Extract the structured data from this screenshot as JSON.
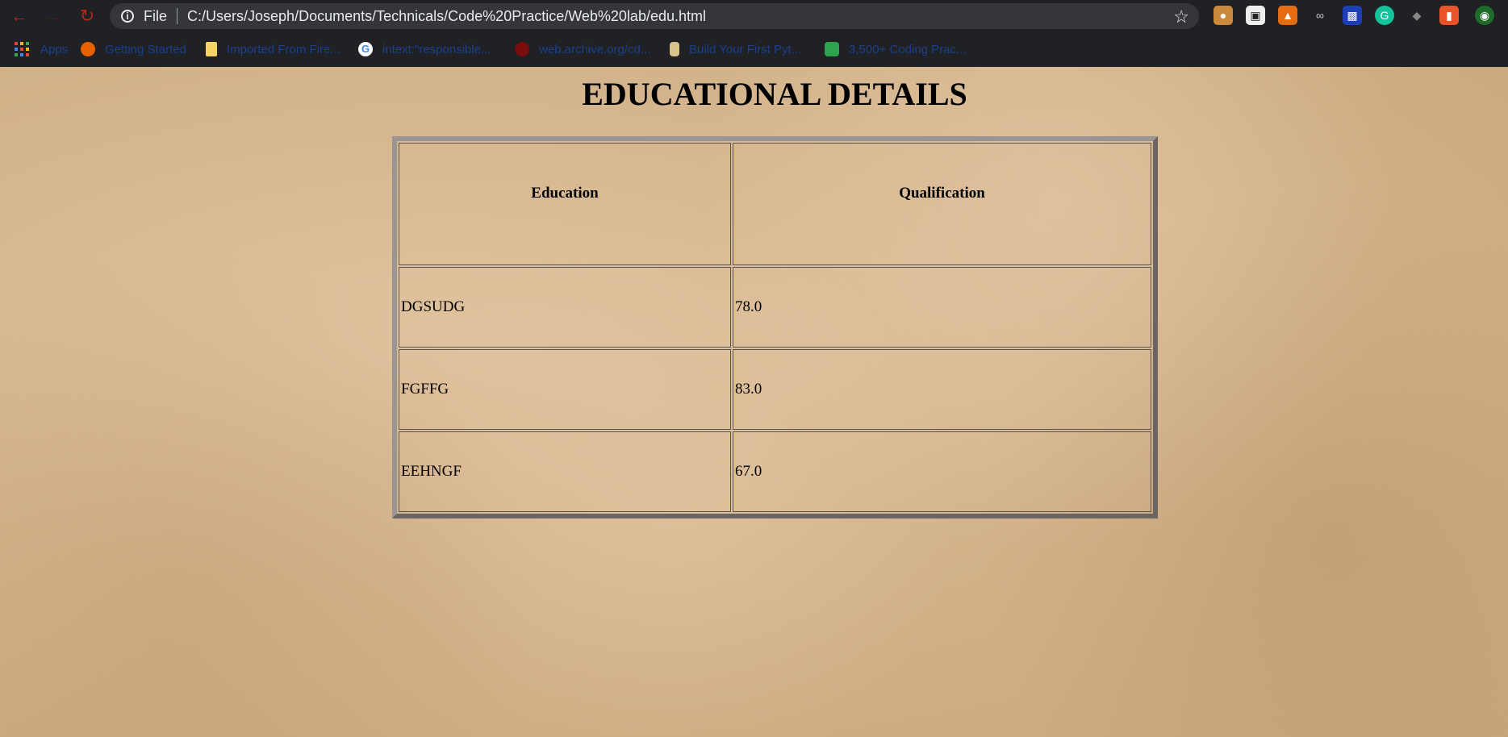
{
  "browser": {
    "address": {
      "scheme_label": "File",
      "url": "C:/Users/Joseph/Documents/Technicals/Code%20Practice/Web%20lab/edu.html"
    },
    "bookmarks": [
      {
        "label": "Apps",
        "icon": "apps-grid-icon"
      },
      {
        "label": "Getting Started",
        "icon": "firefox-icon"
      },
      {
        "label": "Imported From Fire...",
        "icon": "folder-icon"
      },
      {
        "label": "intext:\"responsible...",
        "icon": "google-icon"
      },
      {
        "label": "web.archive.org/cd...",
        "icon": "archive-icon"
      },
      {
        "label": "Build Your First Pyt...",
        "icon": "python-icon"
      },
      {
        "label": "3,500+ Coding Prac...",
        "icon": "coding-icon"
      }
    ],
    "extensions": [
      "cookie-icon",
      "gamepad-icon",
      "fox-icon",
      "link-icon",
      "monitor-icon",
      "grammarly-icon",
      "shield-icon",
      "bookmark-icon",
      "globe-icon"
    ]
  },
  "page": {
    "title": "EDUCATIONAL DETAILS",
    "table": {
      "headers": [
        "Education",
        "Qualification"
      ],
      "rows": [
        [
          "DGSUDG",
          "78.0"
        ],
        [
          "FGFFG",
          "83.0"
        ],
        [
          "EEHNGF",
          "67.0"
        ]
      ]
    }
  }
}
